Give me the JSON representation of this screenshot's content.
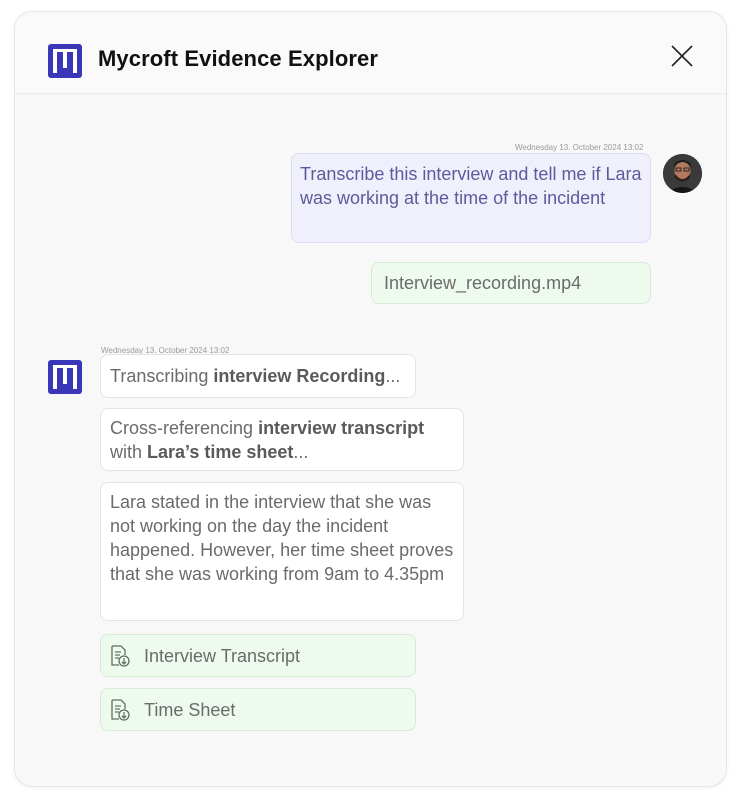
{
  "app": {
    "title": "Mycroft Evidence Explorer"
  },
  "header": {
    "close_label": "Close"
  },
  "colors": {
    "brand": "#3a36b8",
    "user_bubble": "#f0f0fd",
    "file_chip": "#effaef"
  },
  "conversation": {
    "user": {
      "timestamp": "Wednesday 13. October 2024 13:02",
      "message": "Transcribe this interview and tell me if Lara was working at the time of the incident",
      "attachment": "Interview_recording.mp4"
    },
    "assistant": {
      "timestamp": "Wednesday 13. October 2024 13:02",
      "step1": {
        "prefix": "Transcribing ",
        "bold": "interview Recording",
        "suffix": "..."
      },
      "step2": {
        "prefix": "Cross-referencing ",
        "bold1": "interview transcript",
        "middle": " with ",
        "bold2": "Lara’s time sheet",
        "suffix": "..."
      },
      "answer": "Lara stated in the interview that she was not working on the day the incident happened. However, her time sheet proves that she was working from 9am to 4.35pm",
      "files": [
        {
          "name": "Interview Transcript",
          "icon": "file-download-icon"
        },
        {
          "name": "Time Sheet",
          "icon": "file-download-icon"
        }
      ]
    }
  }
}
